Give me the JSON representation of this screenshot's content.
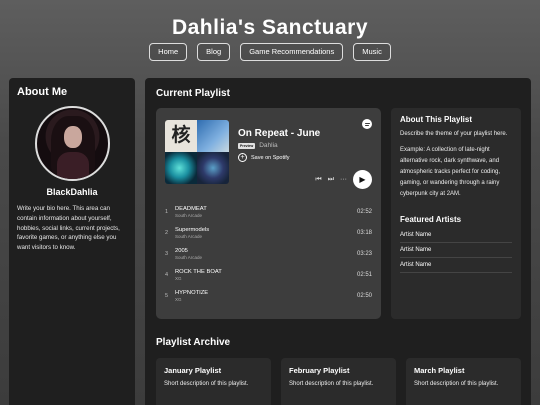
{
  "site": {
    "title": "Dahlia's Sanctuary",
    "nav": [
      "Home",
      "Blog",
      "Game Recommendations",
      "Music"
    ]
  },
  "about": {
    "heading": "About Me",
    "username": "BlackDahlia",
    "bio": "Write your bio here. This area can contain information about yourself, hobbies, social links, current projects, favorite games, or anything else you want visitors to know."
  },
  "playlist": {
    "heading": "Current Playlist",
    "title": "On Repeat - June",
    "badge": "Preview",
    "artist": "Dahlia",
    "save_label": "Save on Spotify",
    "cover_glyph": "核",
    "tracks": [
      {
        "num": "1",
        "name": "DEADMEAT",
        "artist": "South Arcade",
        "duration": "02:52"
      },
      {
        "num": "2",
        "name": "Supermodels",
        "artist": "South Arcade",
        "duration": "03:18"
      },
      {
        "num": "3",
        "name": "2005",
        "artist": "South Arcade",
        "duration": "03:23"
      },
      {
        "num": "4",
        "name": "ROCK THE BOAT",
        "artist": "XG",
        "duration": "02:51"
      },
      {
        "num": "5",
        "name": "HYPNOTIZE",
        "artist": "XG",
        "duration": "02:50"
      }
    ]
  },
  "about_playlist": {
    "heading": "About This Playlist",
    "text1": "Describe the theme of your playlist here.",
    "text2": "Example: A collection of late-night alternative rock, dark synthwave, and atmospheric tracks perfect for coding, gaming, or wandering through a rainy cyberpunk city at 2AM.",
    "featured_heading": "Featured Artists",
    "artists": [
      "Artist Name",
      "Artist Name",
      "Artist Name"
    ]
  },
  "archive": {
    "heading": "Playlist Archive",
    "cards": [
      {
        "title": "January Playlist",
        "desc": "Short description of this playlist."
      },
      {
        "title": "February Playlist",
        "desc": "Short description of this playlist."
      },
      {
        "title": "March Playlist",
        "desc": "Short description of this playlist."
      }
    ]
  }
}
